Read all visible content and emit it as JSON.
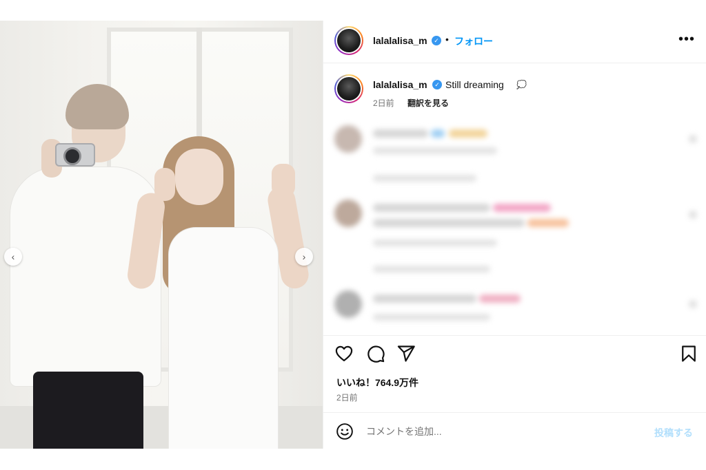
{
  "post": {
    "username": "lalalalisa_m",
    "separator": "•",
    "follow_label": "フォロー",
    "more_label": "•••",
    "verified_mark": "✓"
  },
  "caption": {
    "username": "lalalalisa_m",
    "text": "Still dreaming",
    "emoji": "💭",
    "time": "2日前",
    "translate_label": "翻訳を見る"
  },
  "media": {
    "prev_label": "‹",
    "next_label": "›",
    "dot_count": 14,
    "active_dot": 1
  },
  "stats": {
    "likes": "いいね！764.9万件",
    "time": "2日前"
  },
  "comment_box": {
    "placeholder": "コメントを追加...",
    "post_label": "投稿する"
  },
  "colors": {
    "link": "#0095f6",
    "post_disabled": "#b2dffc",
    "verified": "#3797f0"
  },
  "icons": [
    "heart-icon",
    "comment-icon",
    "share-icon",
    "bookmark-icon",
    "emoji-icon",
    "verified-badge-icon",
    "more-icon"
  ]
}
